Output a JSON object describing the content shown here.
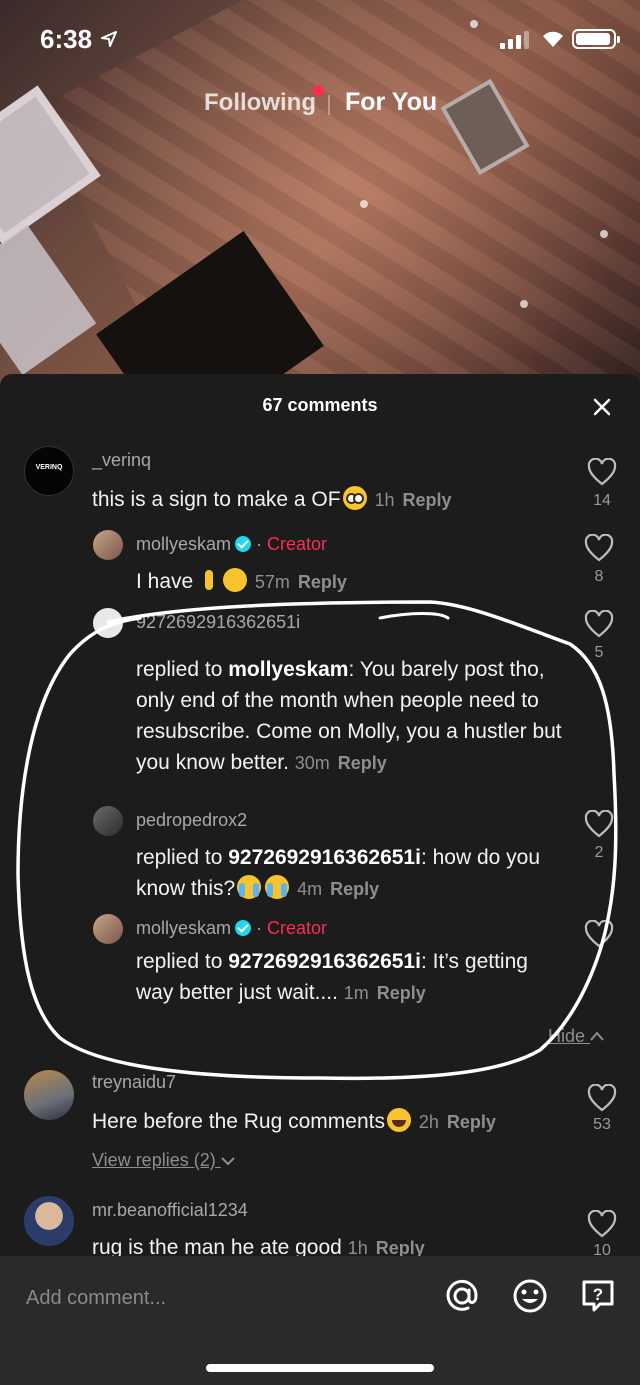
{
  "status_bar": {
    "time": "6:38",
    "battery_level": 0.95
  },
  "top_tabs": {
    "following": "Following",
    "for_you": "For You"
  },
  "sheet": {
    "title": "67 comments"
  },
  "comments": [
    {
      "username": "_verinq",
      "avatar_text": "VERINQ",
      "text": "this is a sign to make a OF",
      "time": "1h",
      "reply": "Reply",
      "likes": "14"
    },
    {
      "username": "mollyeskam",
      "creator": "Creator",
      "text": "I have",
      "time": "57m",
      "reply": "Reply",
      "likes": "8"
    },
    {
      "username": "9272692916362651i",
      "reply_prefix": "replied to",
      "reply_to": "mollyeskam",
      "text": ": You barely post tho, only end of the month when people need to resubscribe. Come on Molly, you a hustler but you know better.",
      "time": "30m",
      "reply": "Reply",
      "likes": "5"
    },
    {
      "username": "pedropedrox2",
      "reply_prefix": "replied to",
      "reply_to": "9272692916362651i",
      "text": ": how do you know this?",
      "time": "4m",
      "reply": "Reply",
      "likes": "2"
    },
    {
      "username": "mollyeskam",
      "creator": "Creator",
      "reply_prefix": "replied to",
      "reply_to": "9272692916362651i",
      "text": ": It’s getting way better just wait....",
      "time": "1m",
      "reply": "Reply",
      "likes": ""
    },
    {
      "username": "treynaidu7",
      "text": "Here before the Rug comments",
      "time": "2h",
      "reply": "Reply",
      "likes": "53",
      "view_replies": "View replies (2)"
    },
    {
      "username": "mr.beanofficial1234",
      "text": "rug is the man he ate good",
      "time": "1h",
      "reply": "Reply",
      "likes": "10"
    }
  ],
  "hide_label": "Hide",
  "input": {
    "placeholder": "Add comment..."
  },
  "colors": {
    "accent": "#fe2c55",
    "verified": "#20d5ec",
    "sheet_bg": "#1c1c1c"
  },
  "icons": [
    "location-icon",
    "signal-icon",
    "wifi-icon",
    "battery-icon",
    "close-icon",
    "heart-icon",
    "at-icon",
    "emoji-icon",
    "question-icon",
    "verified-icon"
  ]
}
